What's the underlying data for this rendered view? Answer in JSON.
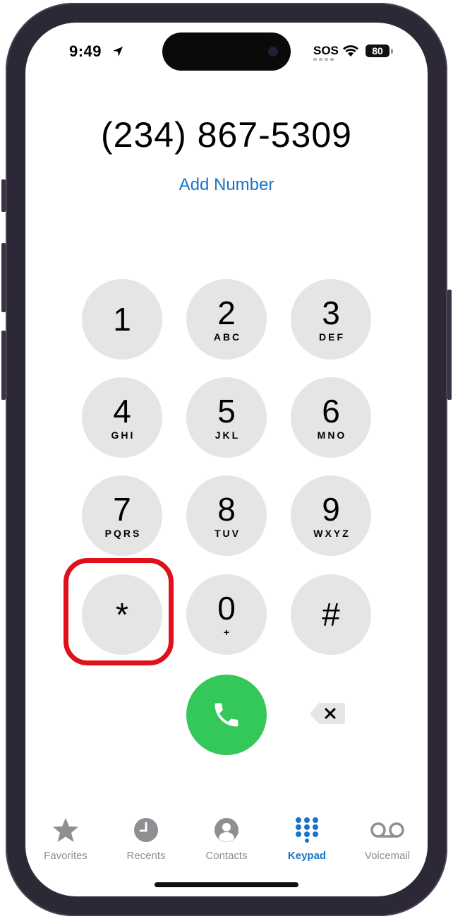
{
  "status_bar": {
    "time": "9:49",
    "sos": "SOS",
    "battery": "80"
  },
  "dialer": {
    "number": "(234) 867-5309",
    "add_number": "Add Number"
  },
  "keys": [
    {
      "digit": "1",
      "letters": ""
    },
    {
      "digit": "2",
      "letters": "ABC"
    },
    {
      "digit": "3",
      "letters": "DEF"
    },
    {
      "digit": "4",
      "letters": "GHI"
    },
    {
      "digit": "5",
      "letters": "JKL"
    },
    {
      "digit": "6",
      "letters": "MNO"
    },
    {
      "digit": "7",
      "letters": "PQRS"
    },
    {
      "digit": "8",
      "letters": "TUV"
    },
    {
      "digit": "9",
      "letters": "WXYZ"
    },
    {
      "digit": "*",
      "letters": ""
    },
    {
      "digit": "0",
      "letters": "+"
    },
    {
      "digit": "#",
      "letters": ""
    }
  ],
  "highlighted_key": "*",
  "colors": {
    "accent": "#1a73c9",
    "call": "#34c759",
    "key_bg": "#e5e5e5",
    "highlight": "#e0101b"
  },
  "tabs": [
    {
      "label": "Favorites",
      "icon": "star-icon",
      "active": false
    },
    {
      "label": "Recents",
      "icon": "clock-icon",
      "active": false
    },
    {
      "label": "Contacts",
      "icon": "person-icon",
      "active": false
    },
    {
      "label": "Keypad",
      "icon": "keypad-icon",
      "active": true
    },
    {
      "label": "Voicemail",
      "icon": "voicemail-icon",
      "active": false
    }
  ]
}
